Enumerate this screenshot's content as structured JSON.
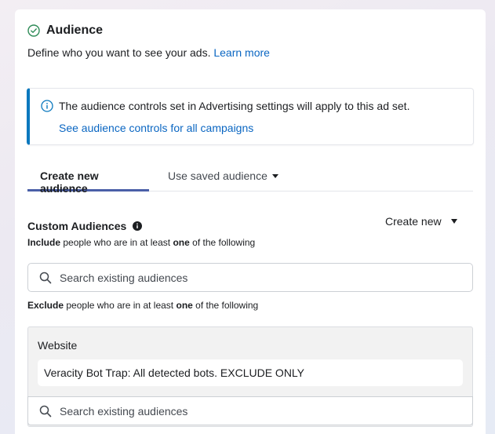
{
  "section": {
    "title": "Audience",
    "description": "Define who you want to see your ads.",
    "learn_more": "Learn more"
  },
  "notice": {
    "text": "The audience controls set in Advertising settings will apply to this ad set.",
    "link": "See audience controls for all campaigns"
  },
  "tabs": [
    {
      "label": "Create new audience",
      "active": true
    },
    {
      "label": "Use saved audience",
      "active": false
    }
  ],
  "custom_audiences": {
    "title": "Custom Audiences",
    "create_new": "Create new",
    "include": {
      "prefix": "Include",
      "middle": "people who are in at least",
      "bold": "one",
      "suffix": "of the following"
    },
    "include_search_placeholder": "Search existing audiences",
    "exclude": {
      "prefix": "Exclude",
      "middle": "people who are in at least",
      "bold": "one",
      "suffix": "of the following"
    },
    "exclude_group_label": "Website",
    "excluded_audience": "Veracity Bot Trap: All detected bots. EXCLUDE ONLY",
    "exclude_search_placeholder": "Search existing audiences"
  },
  "colors": {
    "accent": "#0a66c2",
    "tab_underline": "#4a5fa8",
    "check": "#2e8b57"
  }
}
